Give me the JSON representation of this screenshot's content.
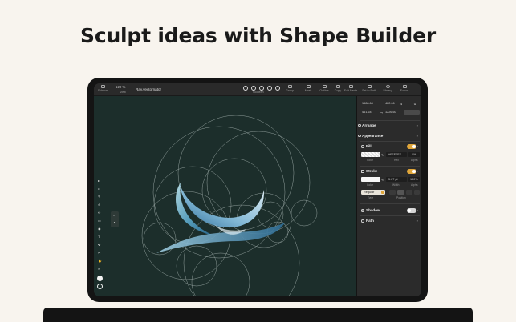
{
  "headline": "Sculpt ideas with Shape Builder",
  "toolbar": {
    "sidebar_label": "Sidebar",
    "zoom": "120 %",
    "view_label": "View",
    "document_title": "Ray.vectornator",
    "boolean_label": "Boolean",
    "group_label": "Group",
    "mask_label": "Mask",
    "outline_label": "Outline",
    "copy_label": "Copy",
    "edit_label": "Edit Paste",
    "stroke_path_label": "Set to Path",
    "library_label": "Library",
    "export_label": "Export"
  },
  "inspector": {
    "x_value": "1588.64",
    "y_value": "422.06",
    "w_value": "461.64",
    "h_value": "1226.60",
    "arrange_label": "Arrange",
    "appearance_label": "Appearance",
    "fill": {
      "label": "Fill",
      "hex": "#FFFFFF",
      "alpha": "1%",
      "color_caption": "Color",
      "hex_caption": "Hex",
      "alpha_caption": "Alpha"
    },
    "stroke": {
      "label": "Stroke",
      "width": "5.67 pt",
      "alpha": "100%",
      "color_caption": "Color",
      "width_caption": "Width",
      "alpha_caption": "Alpha",
      "type_value": "Regular",
      "type_caption": "Type",
      "position_caption": "Position"
    },
    "shadow_label": "Shadow",
    "path_label": "Path"
  },
  "colors": {
    "background": "#f8f4ee",
    "canvas": "#1c2e2b",
    "toggle_on": "#e0a63a",
    "toggle_off": "#d6d6d6"
  }
}
